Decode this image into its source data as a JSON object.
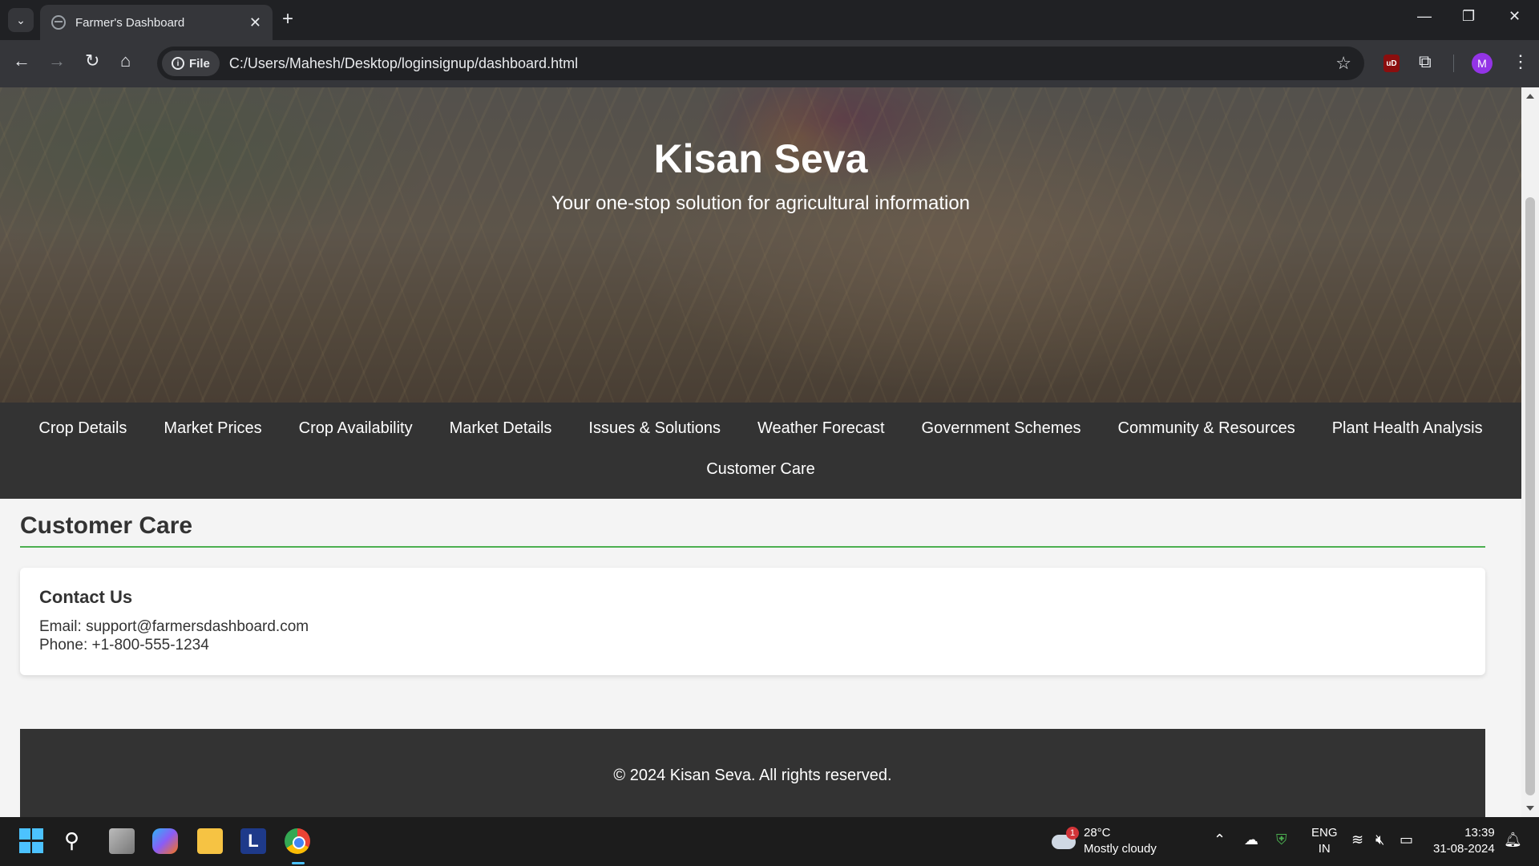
{
  "browser": {
    "tab_title": "Farmer's Dashboard",
    "url_chip": "File",
    "url": "C:/Users/Mahesh/Desktop/loginsignup/dashboard.html",
    "profile_initial": "M",
    "ublock_label": "uD"
  },
  "hero": {
    "title": "Kisan Seva",
    "subtitle": "Your one-stop solution for agricultural information"
  },
  "nav": {
    "items": [
      "Crop Details",
      "Market Prices",
      "Crop Availability",
      "Market Details",
      "Issues & Solutions",
      "Weather Forecast",
      "Government Schemes",
      "Community & Resources",
      "Plant Health Analysis",
      "Customer Care"
    ]
  },
  "section": {
    "title": "Customer Care",
    "card": {
      "heading": "Contact Us",
      "email": "Email: support@farmersdashboard.com",
      "phone": "Phone: +1-800-555-1234"
    }
  },
  "footer": {
    "text": "© 2024 Kisan Seva. All rights reserved."
  },
  "taskbar": {
    "l_app": "L",
    "weather_badge": "1",
    "temperature": "28°C",
    "weather": "Mostly cloudy",
    "lang_top": "ENG",
    "lang_bottom": "IN",
    "time": "13:39",
    "date": "31-08-2024"
  },
  "icons": {
    "tab_search": "chevron-down-icon",
    "back": "arrow-left-icon",
    "forward": "arrow-right-icon",
    "reload": "reload-icon",
    "home": "home-icon",
    "bookmark": "star-icon",
    "extensions": "puzzle-icon",
    "menu": "kebab-menu-icon"
  }
}
